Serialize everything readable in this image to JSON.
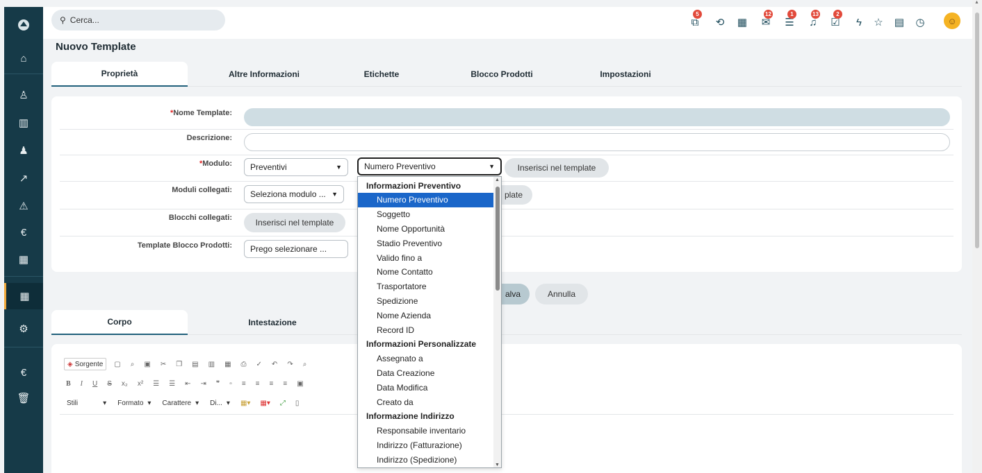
{
  "header": {
    "search_placeholder": "Cerca...",
    "icons": [
      {
        "name": "workflow-icon",
        "glyph": "⧉",
        "badge": "5"
      },
      {
        "name": "history-icon",
        "glyph": "⟲",
        "badge": ""
      },
      {
        "name": "calendar-icon",
        "glyph": "▦",
        "badge": ""
      },
      {
        "name": "mail-icon",
        "glyph": "✉",
        "badge": "12"
      },
      {
        "name": "chat-icon",
        "glyph": "☰",
        "badge": "1"
      },
      {
        "name": "notification-icon",
        "glyph": "♫",
        "badge": "13"
      },
      {
        "name": "tasks-icon",
        "glyph": "☑",
        "badge": "2"
      },
      {
        "name": "lightning-icon",
        "glyph": "ϟ",
        "badge": ""
      },
      {
        "name": "star-icon",
        "glyph": "☆",
        "badge": ""
      },
      {
        "name": "document-icon",
        "glyph": "▤",
        "badge": ""
      },
      {
        "name": "timer-icon",
        "glyph": "◷",
        "badge": ""
      }
    ]
  },
  "sidebar": {
    "icons": [
      "logo-icon",
      "home-icon",
      "contacts-icon",
      "companies-icon",
      "user-icon",
      "trend-icon",
      "warning-icon",
      "euro-icon",
      "grid-icon",
      "apps-icon",
      "settings-icon",
      "euro2-icon",
      "trash-icon"
    ]
  },
  "page": {
    "title": "Nuovo Template",
    "tabs": [
      "Proprietà",
      "Altre Informazioni",
      "Etichette",
      "Blocco Prodotti",
      "Impostazioni"
    ],
    "active_tab": "Proprietà"
  },
  "form": {
    "required_mark": "*",
    "nome_template_label": "Nome Template:",
    "descrizione_label": "Descrizione:",
    "modulo_label": "Modulo:",
    "modulo_value": "Preventivi",
    "field_value": "Numero Preventivo",
    "inserisci_label": "Inserisci nel template",
    "moduli_collegati_label": "Moduli collegati:",
    "moduli_collegati_value": "Seleziona modulo ...",
    "moduli_collegati_btn_partial": "plate",
    "blocchi_collegati_label": "Blocchi collegati:",
    "blocchi_btn": "Inserisci nel template",
    "template_blocco_label": "Template Blocco Prodotti:",
    "template_blocco_value": "Prego selezionare ..."
  },
  "actions": {
    "save_partial": "alva",
    "cancel": "Annulla"
  },
  "editor": {
    "tabs": [
      "Corpo",
      "Intestazione"
    ],
    "active_tab": "Corpo",
    "source_label": "Sorgente",
    "combo_styles": "Stili",
    "combo_format": "Formato",
    "combo_font": "Carattere",
    "combo_size": "Di..."
  },
  "dropdown": {
    "selected": "Numero Preventivo",
    "items": [
      {
        "text": "Informazioni Preventivo",
        "group": true
      },
      {
        "text": "Numero Preventivo",
        "group": false
      },
      {
        "text": "Soggetto",
        "group": false
      },
      {
        "text": "Nome Opportunità",
        "group": false
      },
      {
        "text": "Stadio Preventivo",
        "group": false
      },
      {
        "text": "Valido fino a",
        "group": false
      },
      {
        "text": "Nome Contatto",
        "group": false
      },
      {
        "text": "Trasportatore",
        "group": false
      },
      {
        "text": "Spedizione",
        "group": false
      },
      {
        "text": "Nome Azienda",
        "group": false
      },
      {
        "text": "Record ID",
        "group": false
      },
      {
        "text": "Informazioni Personalizzate",
        "group": true
      },
      {
        "text": "Assegnato a",
        "group": false
      },
      {
        "text": "Data Creazione",
        "group": false
      },
      {
        "text": "Data Modifica",
        "group": false
      },
      {
        "text": "Creato da",
        "group": false
      },
      {
        "text": "Informazione Indirizzo",
        "group": true
      },
      {
        "text": "Responsabile inventario",
        "group": false
      },
      {
        "text": "Indirizzo (Fatturazione)",
        "group": false
      },
      {
        "text": "Indirizzo (Spedizione)",
        "group": false
      }
    ]
  },
  "colors": {
    "sidebar": "#163a48",
    "accent": "#1f5f7a",
    "selected": "#1a66c9",
    "badge": "#e24a3b"
  }
}
